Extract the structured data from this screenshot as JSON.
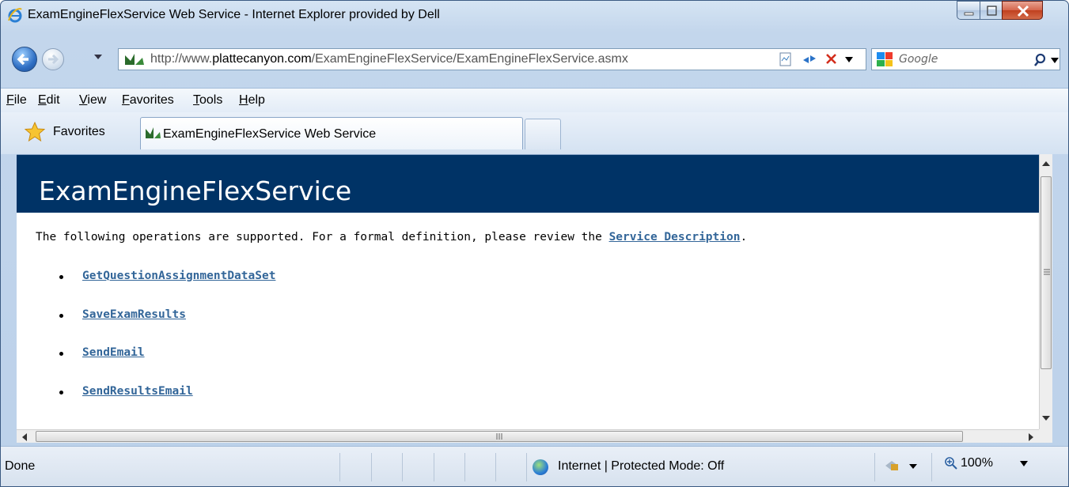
{
  "window": {
    "title": "ExamEngineFlexService Web Service - Internet Explorer provided by Dell"
  },
  "address": {
    "url_prefix": "http://www.",
    "url_domain": "plattecanyon.com",
    "url_path": "/ExamEngineFlexService/ExamEngineFlexService.asmx"
  },
  "search": {
    "placeholder": "Google"
  },
  "menu": {
    "items": [
      "File",
      "Edit",
      "View",
      "Favorites",
      "Tools",
      "Help"
    ]
  },
  "favorites": {
    "label": "Favorites"
  },
  "tabs": [
    {
      "label": "ExamEngineFlexService Web Service"
    }
  ],
  "page": {
    "heading": "ExamEngineFlexService",
    "intro_text": "The following operations are supported. For a formal definition, please review the ",
    "intro_link": "Service Description",
    "intro_end": ".",
    "operations": [
      "GetQuestionAssignmentDataSet",
      "SaveExamResults",
      "SendEmail",
      "SendResultsEmail"
    ]
  },
  "status": {
    "text": "Done",
    "zone": "Internet | Protected Mode: Off",
    "zoom": "100%"
  },
  "colors": {
    "banner": "#003366",
    "link": "#336699"
  }
}
